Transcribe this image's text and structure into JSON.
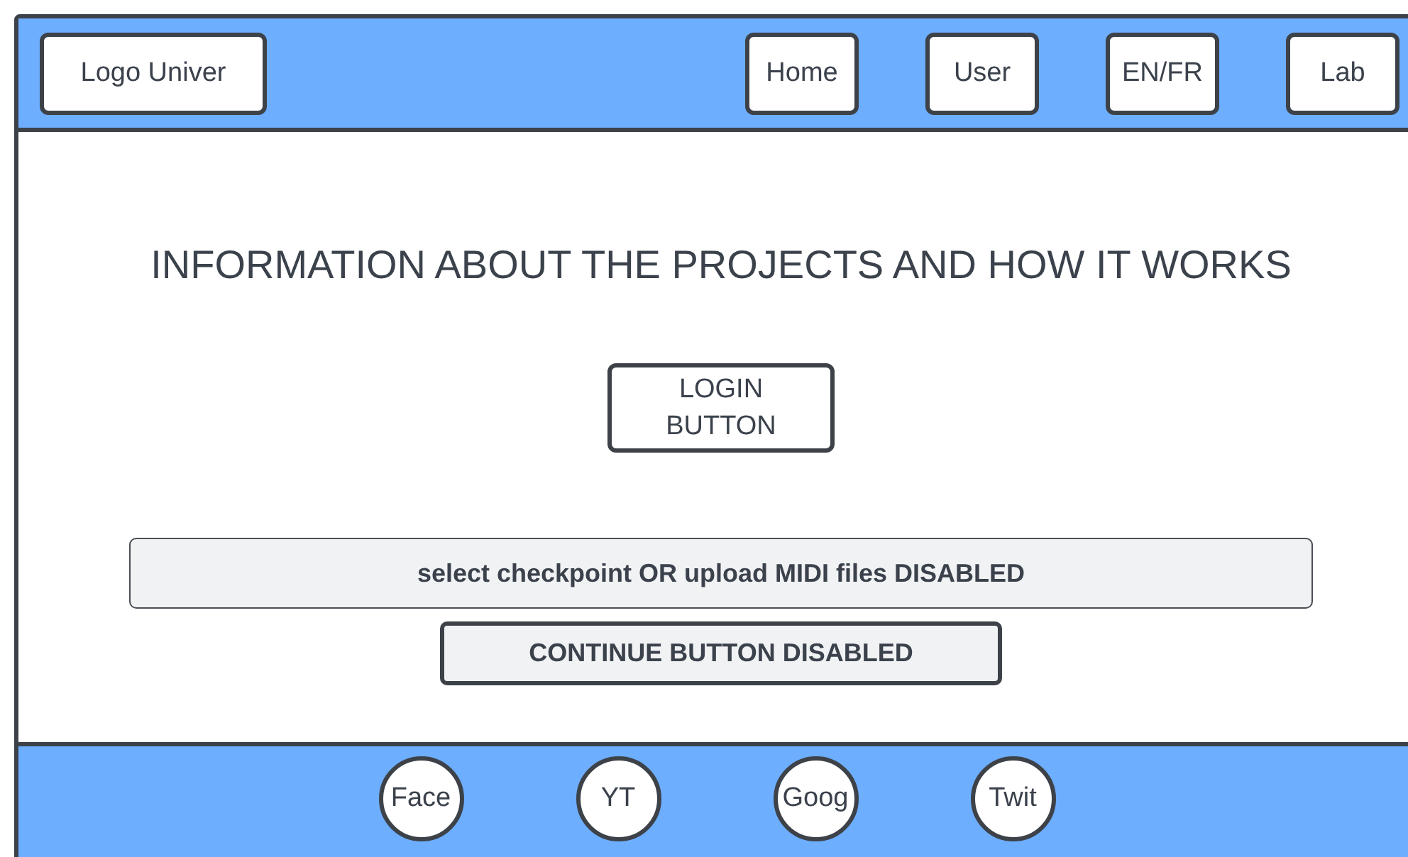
{
  "header": {
    "logo": "Logo Univer",
    "nav": [
      {
        "label": "Home"
      },
      {
        "label": "User"
      },
      {
        "label": "EN/FR"
      },
      {
        "label": "Lab"
      }
    ]
  },
  "main": {
    "heading": "INFORMATION ABOUT THE PROJECTS AND HOW IT WORKS",
    "login_button": "LOGIN BUTTON",
    "file_field": {
      "value": "select checkpoint OR upload MIDI files DISABLED",
      "disabled": true
    },
    "continue_button": {
      "label": "CONTINUE BUTTON DISABLED",
      "disabled": true
    }
  },
  "footer": {
    "links": [
      {
        "label": "Face"
      },
      {
        "label": "YT"
      },
      {
        "label": "Goog"
      },
      {
        "label": "Twit"
      }
    ]
  }
}
